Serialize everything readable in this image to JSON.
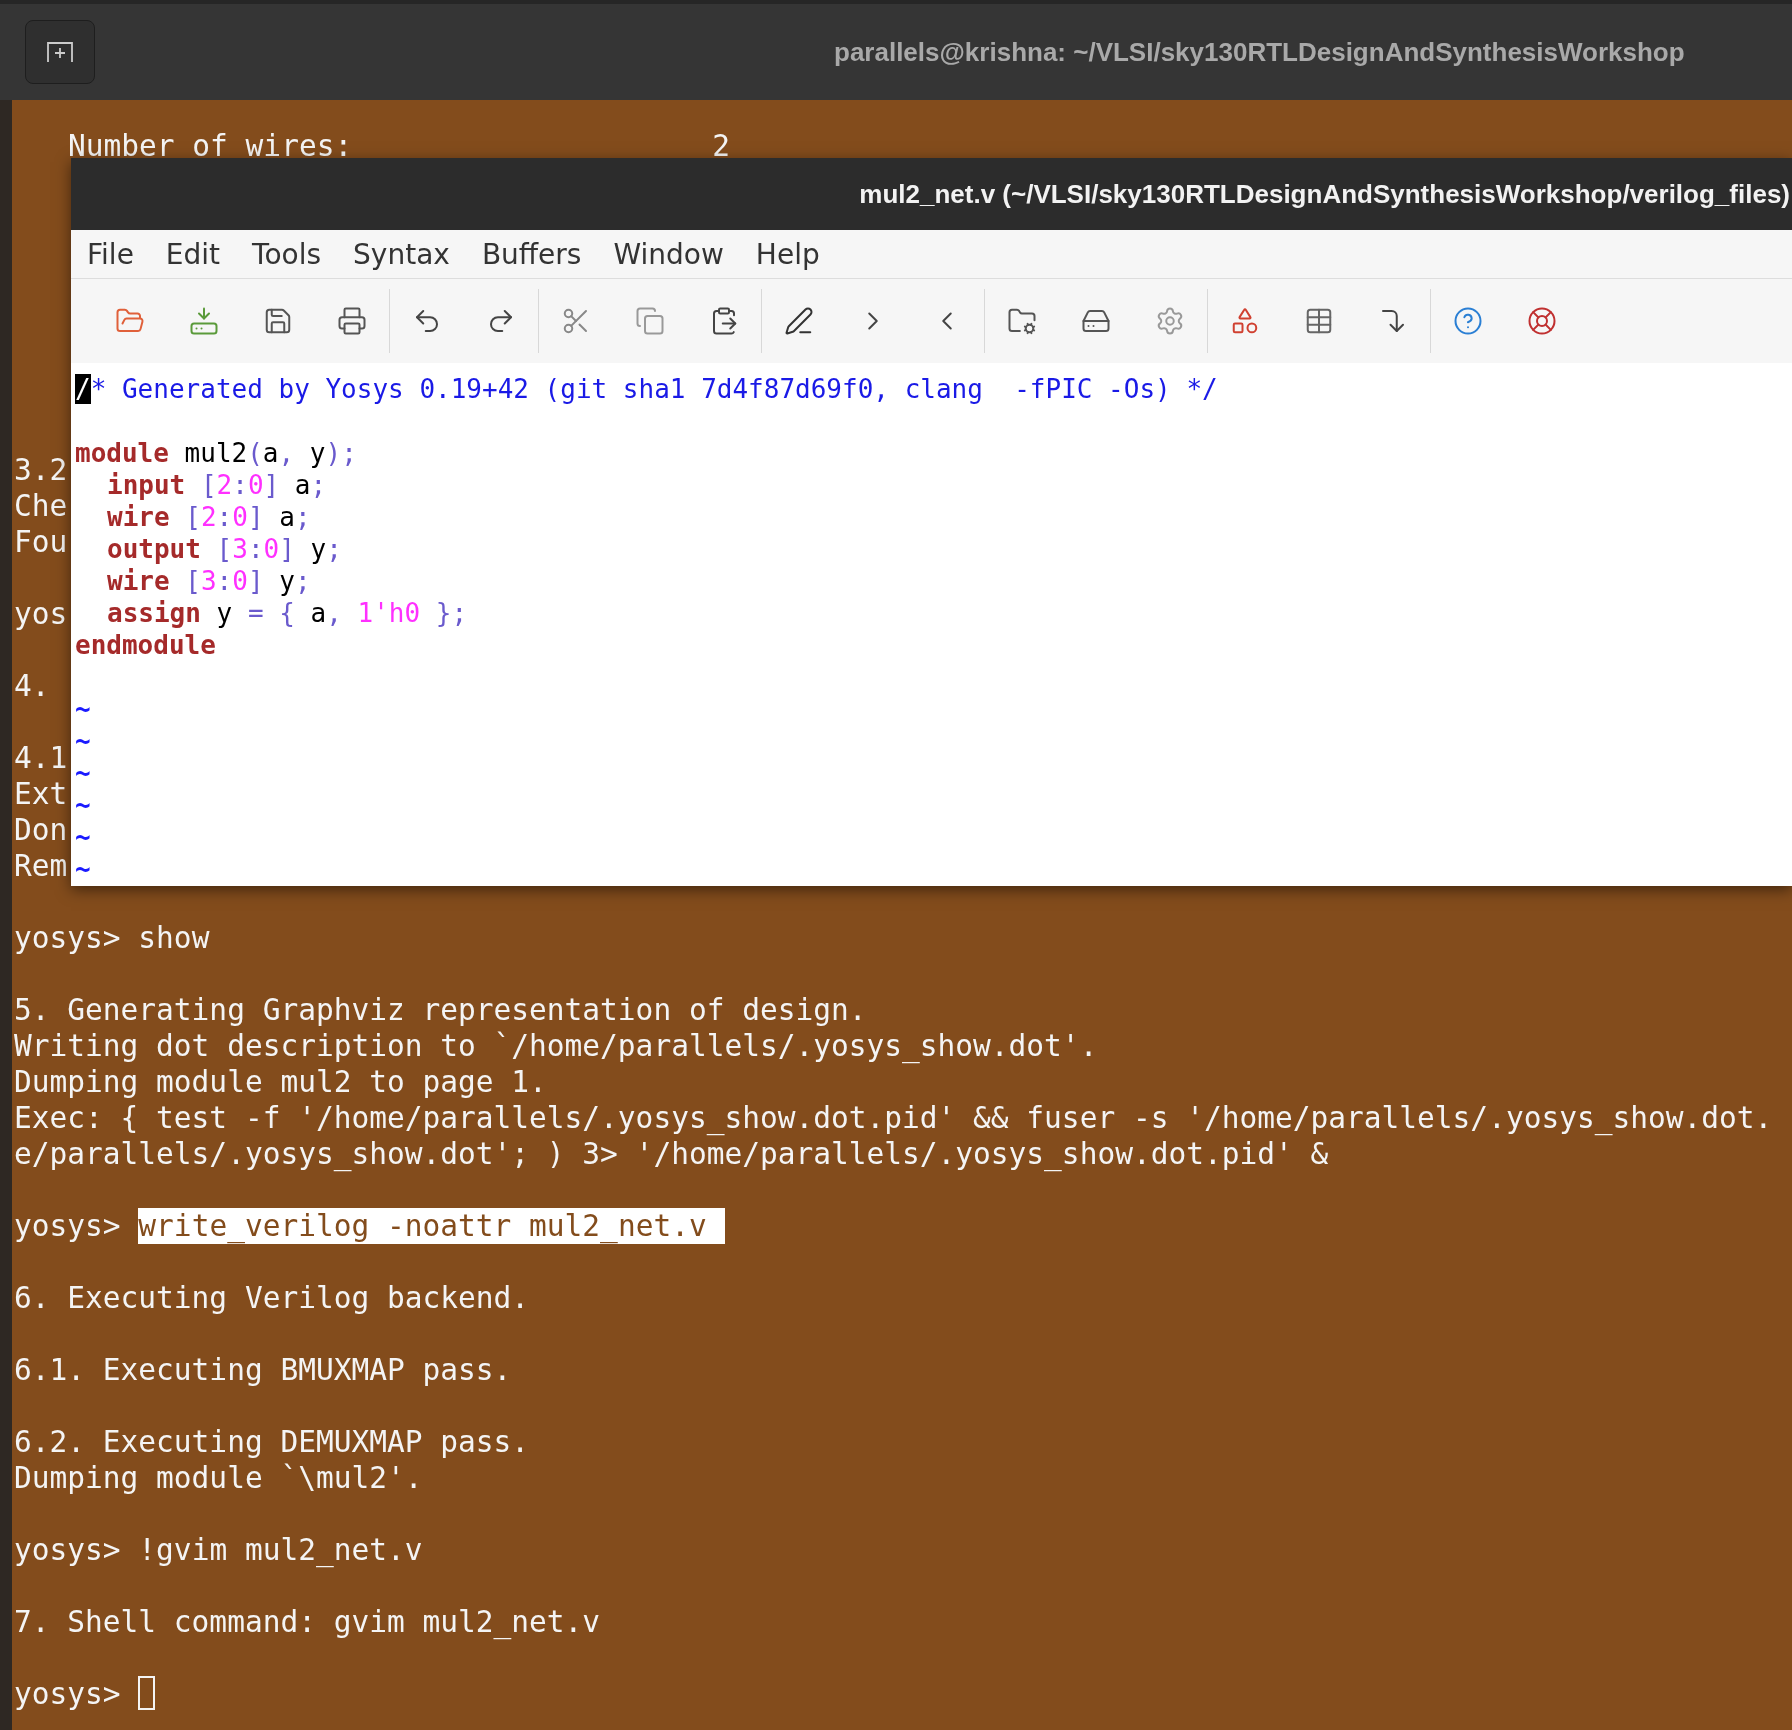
{
  "terminal": {
    "title": "parallels@krishna: ~/VLSI/sky130RTLDesignAndSynthesisWorkshop",
    "stat": {
      "label": "Number of wires:",
      "value": "2"
    },
    "blocks": [
      [
        {
          "kind": "output",
          "text": "3.2"
        },
        {
          "kind": "output",
          "text": "Che"
        },
        {
          "kind": "output",
          "text": "Fou"
        }
      ],
      [
        {
          "kind": "output",
          "text": "yos"
        }
      ],
      [
        {
          "kind": "output",
          "text": "4."
        }
      ],
      [
        {
          "kind": "output",
          "text": "4.1"
        },
        {
          "kind": "output",
          "text": "Ext"
        },
        {
          "kind": "output",
          "text": "Don"
        },
        {
          "kind": "output",
          "text": "Rem"
        }
      ],
      [
        {
          "kind": "prompt",
          "prompt": "yosys>",
          "command": "show",
          "selected": false
        }
      ],
      [
        {
          "kind": "output",
          "text": "5. Generating Graphviz representation of design."
        },
        {
          "kind": "output",
          "text": "Writing dot description to `/home/parallels/.yosys_show.dot'."
        },
        {
          "kind": "output",
          "text": "Dumping module mul2 to page 1."
        },
        {
          "kind": "output",
          "text": "Exec: { test -f '/home/parallels/.yosys_show.dot.pid' && fuser -s '/home/parallels/.yosys_show.dot."
        },
        {
          "kind": "output",
          "text": "e/parallels/.yosys_show.dot'; ) 3> '/home/parallels/.yosys_show.dot.pid' &"
        }
      ],
      [
        {
          "kind": "prompt",
          "prompt": "yosys>",
          "command": "write_verilog -noattr mul2_net.v",
          "selected": true
        }
      ],
      [
        {
          "kind": "output",
          "text": "6. Executing Verilog backend."
        }
      ],
      [
        {
          "kind": "output",
          "text": "6.1. Executing BMUXMAP pass."
        }
      ],
      [
        {
          "kind": "output",
          "text": "6.2. Executing DEMUXMAP pass."
        },
        {
          "kind": "output",
          "text": "Dumping module `\\mul2'."
        }
      ],
      [
        {
          "kind": "prompt",
          "prompt": "yosys>",
          "command": "!gvim mul2_net.v",
          "selected": false
        }
      ],
      [
        {
          "kind": "output",
          "text": "7. Shell command: gvim mul2_net.v"
        }
      ],
      [
        {
          "kind": "prompt",
          "prompt": "yosys>",
          "cursor": true
        }
      ]
    ]
  },
  "gvim": {
    "title": "mul2_net.v (~/VLSI/sky130RTLDesignAndSynthesisWorkshop/verilog_files)",
    "menu": [
      "File",
      "Edit",
      "Tools",
      "Syntax",
      "Buffers",
      "Window",
      "Help"
    ],
    "blocks": [
      [
        {
          "segments": [
            {
              "kind": "comment",
              "text": "/",
              "cursor": true
            },
            {
              "kind": "comment",
              "text": "* Generated by Yosys 0.19+42 (git sha1 7d4f87d69f0, clang  -fPIC -Os) */",
              "cursor": false
            }
          ]
        }
      ],
      [
        {
          "segments": [
            {
              "kind": "keyword",
              "text": "module"
            },
            {
              "kind": "plain",
              "text": " mul2"
            },
            {
              "kind": "op",
              "text": "("
            },
            {
              "kind": "plain",
              "text": "a"
            },
            {
              "kind": "op",
              "text": ", "
            },
            {
              "kind": "plain",
              "text": "y"
            },
            {
              "kind": "op",
              "text": ");"
            }
          ],
          "children": [
            {
              "segments": [
                {
                  "kind": "keyword",
                  "text": "input"
                },
                {
                  "kind": "op",
                  "text": " ["
                },
                {
                  "kind": "number",
                  "text": "2"
                },
                {
                  "kind": "op",
                  "text": ":"
                },
                {
                  "kind": "number",
                  "text": "0"
                },
                {
                  "kind": "op",
                  "text": "]"
                },
                {
                  "kind": "plain",
                  "text": " a"
                },
                {
                  "kind": "op",
                  "text": ";"
                }
              ]
            },
            {
              "segments": [
                {
                  "kind": "keyword",
                  "text": "wire"
                },
                {
                  "kind": "op",
                  "text": " ["
                },
                {
                  "kind": "number",
                  "text": "2"
                },
                {
                  "kind": "op",
                  "text": ":"
                },
                {
                  "kind": "number",
                  "text": "0"
                },
                {
                  "kind": "op",
                  "text": "]"
                },
                {
                  "kind": "plain",
                  "text": " a"
                },
                {
                  "kind": "op",
                  "text": ";"
                }
              ]
            },
            {
              "segments": [
                {
                  "kind": "keyword",
                  "text": "output"
                },
                {
                  "kind": "op",
                  "text": " ["
                },
                {
                  "kind": "number",
                  "text": "3"
                },
                {
                  "kind": "op",
                  "text": ":"
                },
                {
                  "kind": "number",
                  "text": "0"
                },
                {
                  "kind": "op",
                  "text": "]"
                },
                {
                  "kind": "plain",
                  "text": " y"
                },
                {
                  "kind": "op",
                  "text": ";"
                }
              ]
            },
            {
              "segments": [
                {
                  "kind": "keyword",
                  "text": "wire"
                },
                {
                  "kind": "op",
                  "text": " ["
                },
                {
                  "kind": "number",
                  "text": "3"
                },
                {
                  "kind": "op",
                  "text": ":"
                },
                {
                  "kind": "number",
                  "text": "0"
                },
                {
                  "kind": "op",
                  "text": "]"
                },
                {
                  "kind": "plain",
                  "text": " y"
                },
                {
                  "kind": "op",
                  "text": ";"
                }
              ]
            },
            {
              "segments": [
                {
                  "kind": "keyword",
                  "text": "assign"
                },
                {
                  "kind": "plain",
                  "text": " y "
                },
                {
                  "kind": "op",
                  "text": "= { "
                },
                {
                  "kind": "plain",
                  "text": "a"
                },
                {
                  "kind": "op",
                  "text": ", "
                },
                {
                  "kind": "number",
                  "text": "1'h0"
                },
                {
                  "kind": "op",
                  "text": " };"
                }
              ]
            }
          ]
        },
        {
          "segments": [
            {
              "kind": "keyword",
              "text": "endmodule"
            }
          ]
        }
      ]
    ],
    "filler": [
      "~",
      "~",
      "~",
      "~",
      "~",
      "~"
    ]
  }
}
